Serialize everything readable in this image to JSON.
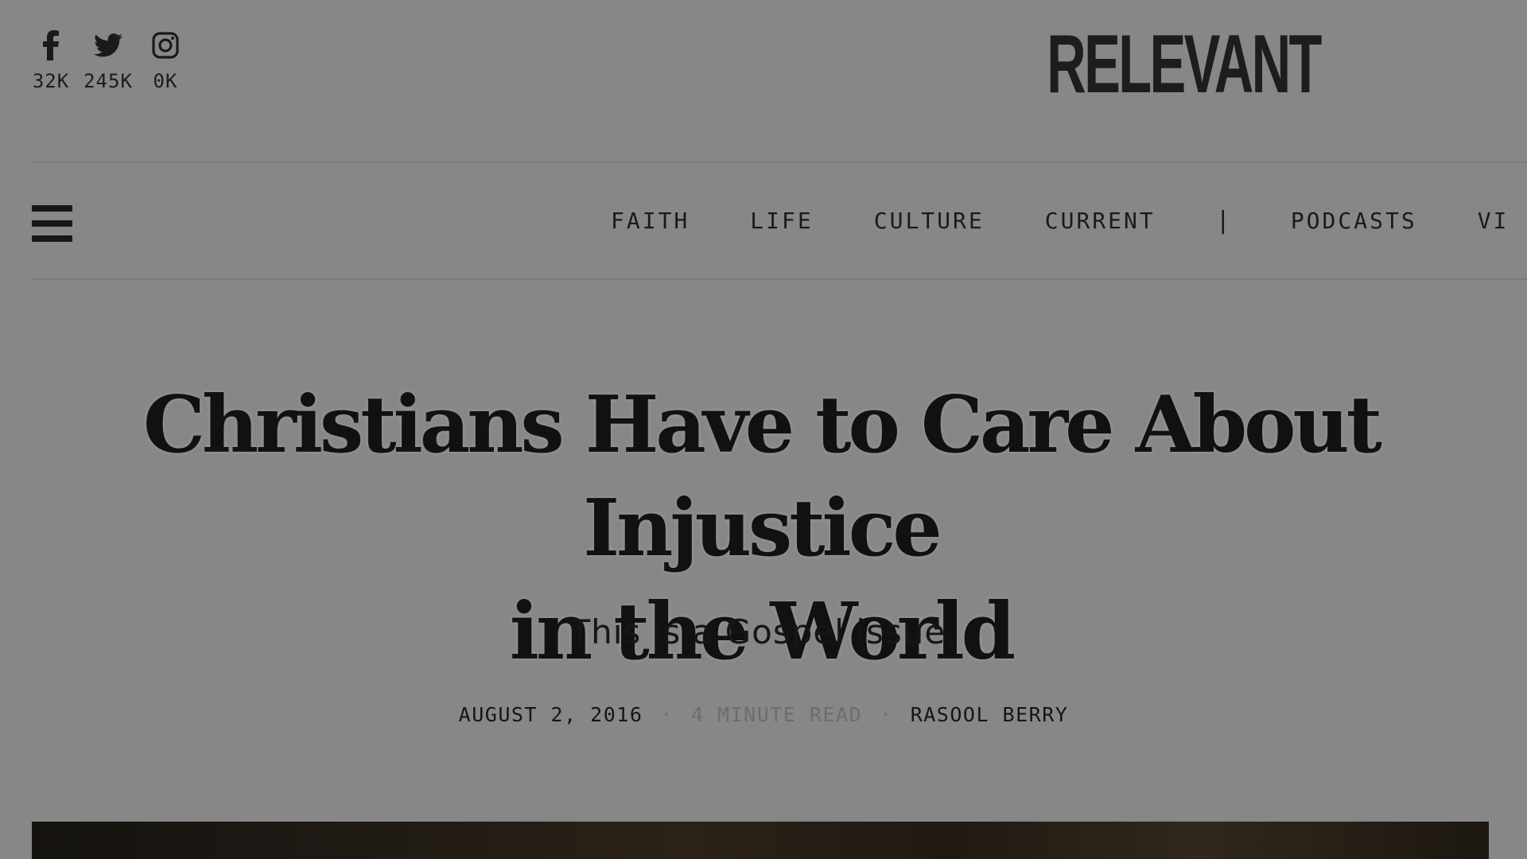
{
  "social": [
    {
      "icon": "facebook-icon",
      "count": "32K"
    },
    {
      "icon": "twitter-icon",
      "count": "245K"
    },
    {
      "icon": "instagram-icon",
      "count": "0K"
    }
  ],
  "brand": {
    "logo_text": "RELEVANT"
  },
  "nav": {
    "items": [
      "FAITH",
      "LIFE",
      "CULTURE",
      "CURRENT",
      "|",
      "PODCASTS",
      "VI"
    ]
  },
  "article": {
    "headline_line1": "Christians Have to Care About Injustice",
    "headline_line2": "in the World",
    "dek": "This is a Gospel issue.",
    "date": "AUGUST 2, 2016",
    "read_time": "4 MINUTE READ",
    "author": "RASOOL BERRY",
    "separator": "·"
  },
  "colors": {
    "overlay_background": "#878787",
    "text": "#161616",
    "muted": "#6d6d6d"
  }
}
